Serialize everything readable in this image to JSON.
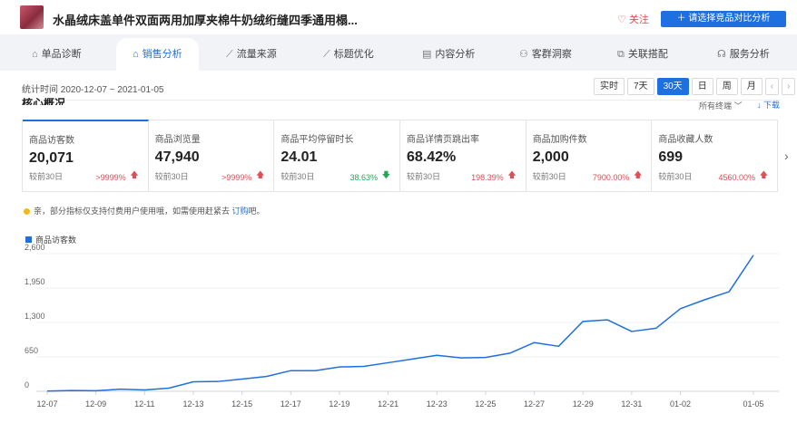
{
  "header": {
    "product_title": "水晶绒床盖单件双面两用加厚夹棉牛奶绒绗缝四季通用榻...",
    "follow_label": "关注",
    "compare_label": "＋ 请选择竞品对比分析"
  },
  "tabs": [
    {
      "label": "单品诊断",
      "icon": "product-icon"
    },
    {
      "label": "销售分析",
      "icon": "cart-icon"
    },
    {
      "label": "流量来源",
      "icon": "trend-icon"
    },
    {
      "label": "标题优化",
      "icon": "trend-icon"
    },
    {
      "label": "内容分析",
      "icon": "document-icon"
    },
    {
      "label": "客群洞察",
      "icon": "users-icon"
    },
    {
      "label": "关联搭配",
      "icon": "link-icon"
    },
    {
      "label": "服务分析",
      "icon": "headset-icon"
    }
  ],
  "active_tab": 1,
  "toolbar": {
    "period": "统计时间 2020-12-07 ~ 2021-01-05",
    "ranges": [
      "实时",
      "7天",
      "30天",
      "日",
      "周",
      "月"
    ],
    "active_range": "30天",
    "prev_label": "‹",
    "next_label": "›"
  },
  "overview": {
    "title": "核心概况",
    "channel_label": "所有终端 ﹀",
    "download_label": "↓ 下载",
    "next_label": "›"
  },
  "metrics": [
    {
      "label": "商品访客数",
      "value": "20,071",
      "compare": "较前30日",
      "change": ">9999%",
      "dir": "up"
    },
    {
      "label": "商品浏览量",
      "value": "47,940",
      "compare": "较前30日",
      "change": ">9999%",
      "dir": "up"
    },
    {
      "label": "商品平均停留时长",
      "value": "24.01",
      "compare": "较前30日",
      "change": "38.63%",
      "dir": "down"
    },
    {
      "label": "商品详情页跳出率",
      "value": "68.42%",
      "compare": "较前30日",
      "change": "198.39%",
      "dir": "up"
    },
    {
      "label": "商品加购件数",
      "value": "2,000",
      "compare": "较前30日",
      "change": "7900.00%",
      "dir": "up"
    },
    {
      "label": "商品收藏人数",
      "value": "699",
      "compare": "较前30日",
      "change": "4560.00%",
      "dir": "up"
    }
  ],
  "notice": {
    "text": "亲，部分指标仅支持付费用户使用哦，如需使用赶紧去 ",
    "link": "订购",
    "suffix": "吧。"
  },
  "colors": {
    "accent": "#1e6fe0",
    "up": "#e34d59",
    "down": "#2aa45a",
    "notice_dot": "#f5b81c"
  },
  "chart_data": {
    "type": "line",
    "legend": "商品访客数",
    "x": [
      "12-07",
      "12-08",
      "12-09",
      "12-10",
      "12-11",
      "12-12",
      "12-13",
      "12-14",
      "12-15",
      "12-16",
      "12-17",
      "12-18",
      "12-19",
      "12-20",
      "12-21",
      "12-22",
      "12-23",
      "12-24",
      "12-25",
      "12-26",
      "12-27",
      "12-28",
      "12-29",
      "12-30",
      "12-31",
      "01-01",
      "01-02",
      "01-03",
      "01-04",
      "01-05"
    ],
    "x_ticks": [
      "12-07",
      "12-09",
      "12-11",
      "12-13",
      "12-15",
      "12-17",
      "12-19",
      "12-21",
      "12-23",
      "12-25",
      "12-27",
      "12-29",
      "12-31",
      "01-02",
      "01-05"
    ],
    "series": [
      {
        "name": "商品访客数",
        "values": [
          5,
          15,
          10,
          40,
          25,
          60,
          180,
          185,
          230,
          280,
          390,
          390,
          460,
          470,
          540,
          610,
          680,
          630,
          640,
          720,
          920,
          850,
          1320,
          1350,
          1130,
          1190,
          1560,
          1730,
          1880,
          2570
        ]
      }
    ],
    "y_ticks": [
      0,
      650,
      1300,
      1950,
      2600
    ],
    "y_tick_labels": [
      "0",
      "650",
      "1,300",
      "1,950",
      "2,600"
    ],
    "ylim": [
      0,
      2600
    ],
    "grid": true
  }
}
